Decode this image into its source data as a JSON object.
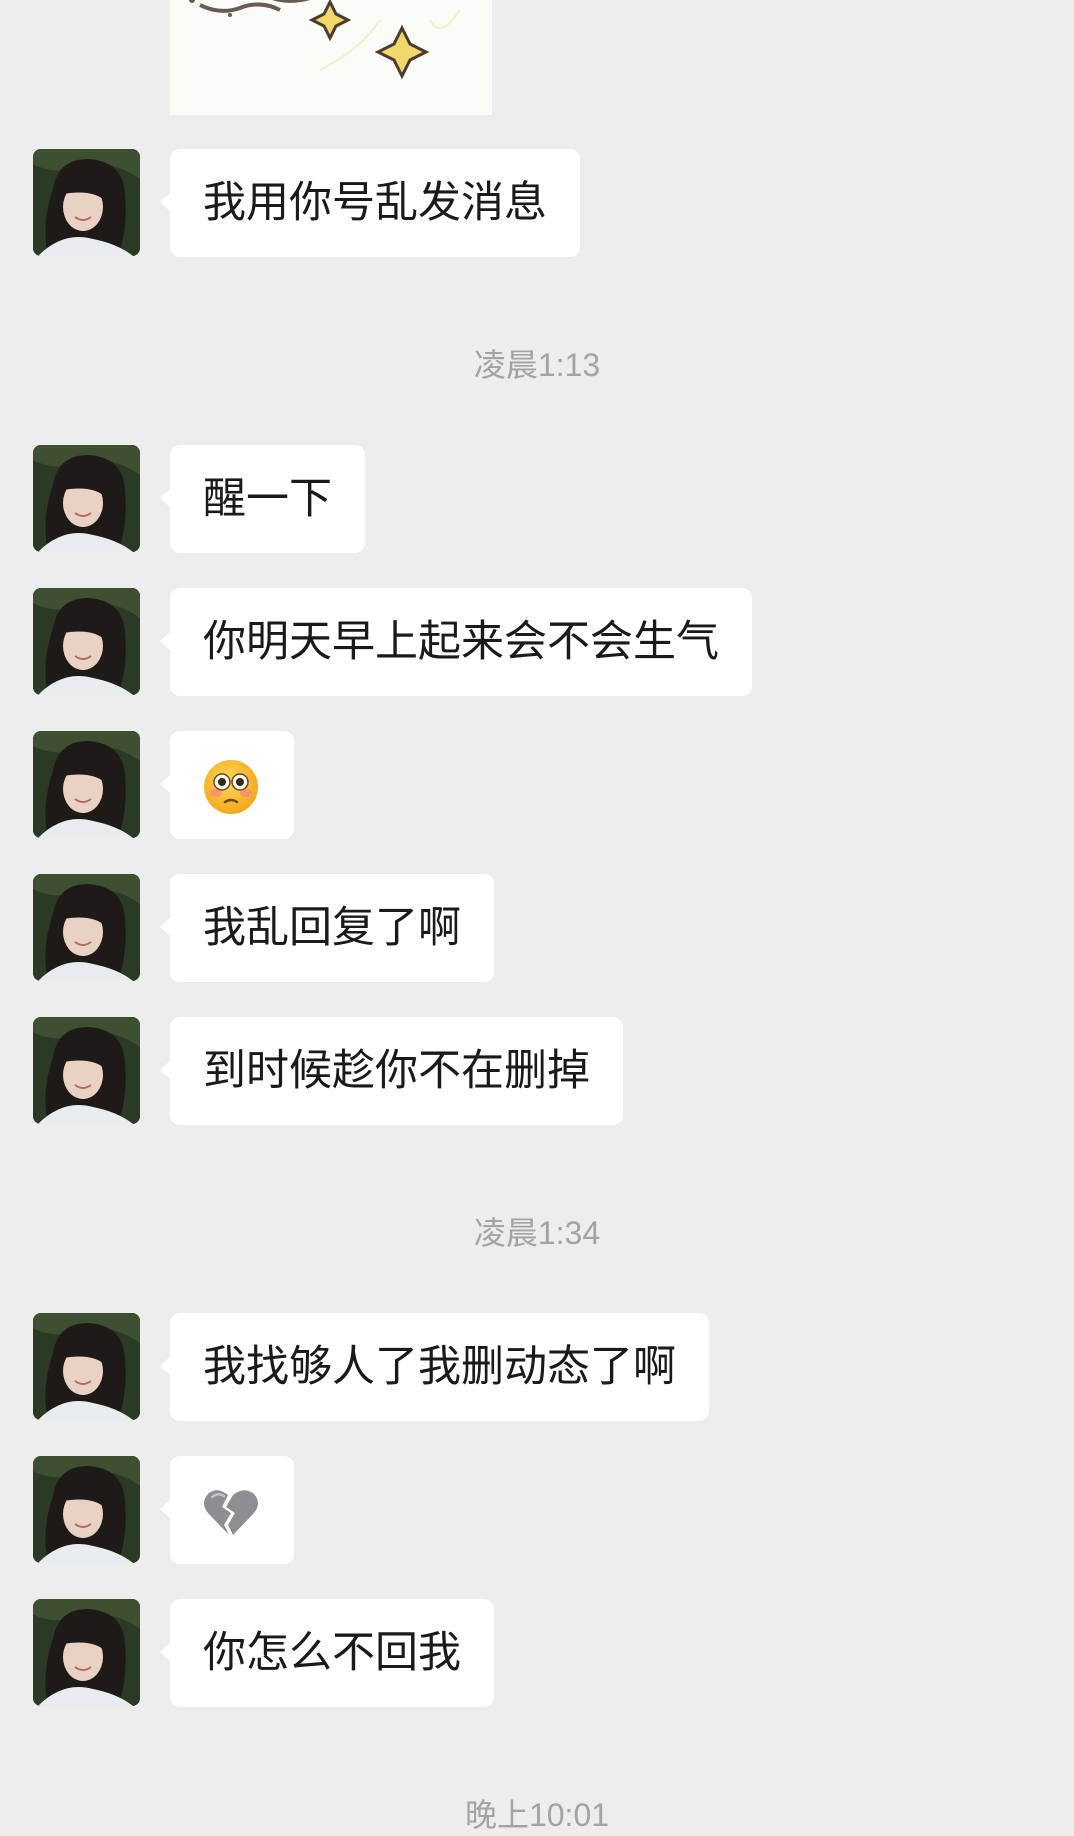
{
  "messages": [
    {
      "type": "text",
      "text": "我用你号乱发消息"
    },
    {
      "type": "time",
      "text": "凌晨1:13"
    },
    {
      "type": "text",
      "text": "醒一下"
    },
    {
      "type": "text",
      "text": "你明天早上起来会不会生气"
    },
    {
      "type": "emoji",
      "icon": "flushed-face-emoji"
    },
    {
      "type": "text",
      "text": "我乱回复了啊"
    },
    {
      "type": "text",
      "text": "到时候趁你不在删掉"
    },
    {
      "type": "time",
      "text": "凌晨1:34"
    },
    {
      "type": "text",
      "text": "我找够人了我删动态了啊"
    },
    {
      "type": "emoji",
      "icon": "broken-heart-emoji"
    },
    {
      "type": "text",
      "text": "你怎么不回我"
    },
    {
      "type": "time",
      "text": "晚上10:01"
    }
  ],
  "colors": {
    "background": "#ededed",
    "bubble": "#ffffff",
    "timestamp": "#a3a3a3"
  }
}
